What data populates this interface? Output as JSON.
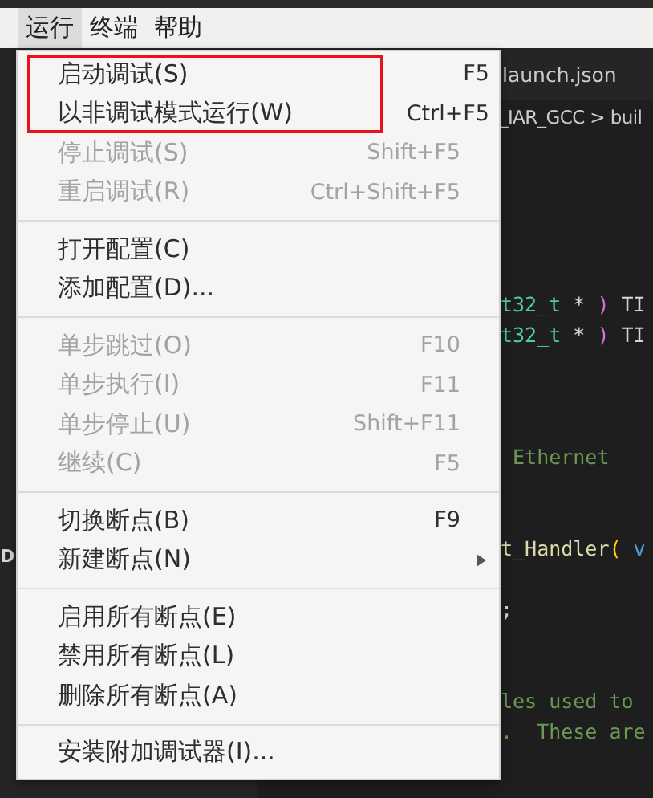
{
  "menubar": [
    {
      "label": "运行",
      "selected": true
    },
    {
      "label": "终端",
      "selected": false
    },
    {
      "label": "帮助",
      "selected": false
    }
  ],
  "sidebar": {
    "fragments": [
      {
        "text": "D",
        "kind": "plain"
      }
    ]
  },
  "editor": {
    "tab": "launch.json",
    "breadcrumb": "_IAR_GCC > buil",
    "lines": [
      {
        "segments": [
          {
            "text": "t32_t",
            "kind": "type"
          },
          {
            "text": " * ",
            "kind": "plain"
          },
          {
            "text": ")",
            "kind": "paren"
          },
          {
            "text": " TI",
            "kind": "plain"
          }
        ]
      },
      {
        "segments": [
          {
            "text": "t32_t",
            "kind": "type"
          },
          {
            "text": " * ",
            "kind": "plain"
          },
          {
            "text": ")",
            "kind": "paren"
          },
          {
            "text": " TI",
            "kind": "plain"
          }
        ]
      },
      {
        "segments": [
          {
            "text": " Ethernet",
            "kind": "comment"
          }
        ]
      },
      {
        "segments": [
          {
            "text": "t_Handler",
            "kind": "func"
          },
          {
            "text": "(",
            "kind": "bracket"
          },
          {
            "text": " v",
            "kind": "keyword"
          }
        ]
      },
      {
        "segments": [
          {
            "text": ";",
            "kind": "plain"
          }
        ]
      },
      {
        "segments": [
          {
            "text": "les used to",
            "kind": "comment"
          }
        ]
      },
      {
        "segments": [
          {
            "text": ".  These are",
            "kind": "comment"
          }
        ]
      }
    ]
  },
  "menu": {
    "groups": [
      {
        "items": [
          {
            "label": "启动调试(S)",
            "shortcut": "F5",
            "disabled": false,
            "highlighted": true,
            "submenu": false
          },
          {
            "label": "以非调试模式运行(W)",
            "shortcut": "Ctrl+F5",
            "disabled": false,
            "highlighted": true,
            "submenu": false
          },
          {
            "label": "停止调试(S)",
            "shortcut": "Shift+F5",
            "disabled": true,
            "highlighted": false,
            "submenu": false
          },
          {
            "label": "重启调试(R)",
            "shortcut": "Ctrl+Shift+F5",
            "disabled": true,
            "highlighted": false,
            "submenu": false
          }
        ]
      },
      {
        "items": [
          {
            "label": "打开配置(C)",
            "disabled": false,
            "highlighted": false,
            "submenu": false
          },
          {
            "label": "添加配置(D)...",
            "disabled": false,
            "highlighted": false,
            "submenu": false
          }
        ]
      },
      {
        "items": [
          {
            "label": "单步跳过(O)",
            "shortcut": "F10",
            "disabled": true,
            "highlighted": false,
            "submenu": false
          },
          {
            "label": "单步执行(I)",
            "shortcut": "F11",
            "disabled": true,
            "highlighted": false,
            "submenu": false
          },
          {
            "label": "单步停止(U)",
            "shortcut": "Shift+F11",
            "disabled": true,
            "highlighted": false,
            "submenu": false
          },
          {
            "label": "继续(C)",
            "shortcut": "F5",
            "disabled": true,
            "highlighted": false,
            "submenu": false
          }
        ]
      },
      {
        "items": [
          {
            "label": "切换断点(B)",
            "shortcut": "F9",
            "disabled": false,
            "highlighted": false,
            "submenu": false
          },
          {
            "label": "新建断点(N)",
            "disabled": false,
            "highlighted": false,
            "submenu": true
          }
        ]
      },
      {
        "items": [
          {
            "label": "启用所有断点(E)",
            "disabled": false,
            "highlighted": false,
            "submenu": false
          },
          {
            "label": "禁用所有断点(L)",
            "disabled": false,
            "highlighted": false,
            "submenu": false
          },
          {
            "label": "删除所有断点(A)",
            "disabled": false,
            "highlighted": false,
            "submenu": false
          }
        ]
      },
      {
        "items": [
          {
            "label": "安装附加调试器(I)...",
            "disabled": false,
            "highlighted": false,
            "submenu": false
          }
        ]
      }
    ]
  }
}
